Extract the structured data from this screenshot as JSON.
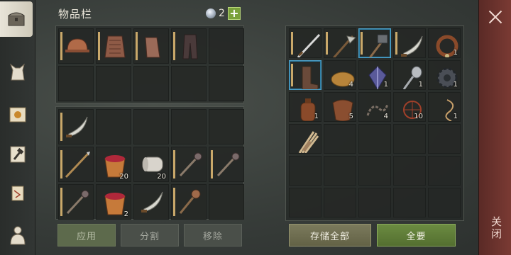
{
  "header": {
    "title": "物品栏",
    "gem_count": "2",
    "plus": "+"
  },
  "equip_slots": [
    {
      "icon": "helmet-icon",
      "count": "",
      "bar": true
    },
    {
      "icon": "chainmail-icon",
      "count": "",
      "bar": true
    },
    {
      "icon": "gloves-icon",
      "count": "",
      "bar": true
    },
    {
      "icon": "pants-icon",
      "count": "",
      "bar": true
    },
    {
      "icon": "",
      "count": "",
      "bar": false
    },
    {
      "icon": "",
      "count": "",
      "bar": false
    },
    {
      "icon": "",
      "count": "",
      "bar": false
    },
    {
      "icon": "",
      "count": "",
      "bar": false
    },
    {
      "icon": "",
      "count": "",
      "bar": false
    },
    {
      "icon": "",
      "count": "",
      "bar": false
    }
  ],
  "bag_slots": [
    {
      "icon": "scimitar-icon",
      "count": "",
      "bar": true
    },
    {
      "icon": "",
      "count": "",
      "bar": false
    },
    {
      "icon": "",
      "count": "",
      "bar": false
    },
    {
      "icon": "",
      "count": "",
      "bar": false
    },
    {
      "icon": "",
      "count": "",
      "bar": false
    },
    {
      "icon": "spear-icon",
      "count": "",
      "bar": true
    },
    {
      "icon": "berry-bucket-icon",
      "count": "20",
      "bar": false
    },
    {
      "icon": "cloth-roll-icon",
      "count": "20",
      "bar": false
    },
    {
      "icon": "mace-icon",
      "count": "",
      "bar": true
    },
    {
      "icon": "mace-icon",
      "count": "",
      "bar": true
    },
    {
      "icon": "mace-icon",
      "count": "",
      "bar": true
    },
    {
      "icon": "berry-bucket-icon",
      "count": "2",
      "bar": false
    },
    {
      "icon": "scimitar-icon",
      "count": "",
      "bar": false
    },
    {
      "icon": "flail-icon",
      "count": "",
      "bar": true
    },
    {
      "icon": "",
      "count": "",
      "bar": false
    }
  ],
  "storage_slots": [
    {
      "icon": "sword-icon",
      "count": "",
      "bar": true
    },
    {
      "icon": "halberd-icon",
      "count": "",
      "bar": true
    },
    {
      "icon": "sledgehammer-icon",
      "count": "",
      "bar": true,
      "selected": true
    },
    {
      "icon": "scimitar-icon",
      "count": "",
      "bar": true
    },
    {
      "icon": "collar-icon",
      "count": "1",
      "bar": false
    },
    {
      "icon": "boots-icon",
      "count": "",
      "bar": true,
      "selected": true
    },
    {
      "icon": "bread-icon",
      "count": "4",
      "bar": false
    },
    {
      "icon": "crystal-icon",
      "count": "1",
      "bar": false
    },
    {
      "icon": "spoon-icon",
      "count": "1",
      "bar": false
    },
    {
      "icon": "gear-icon",
      "count": "1",
      "bar": false
    },
    {
      "icon": "flask-icon",
      "count": "1",
      "bar": false
    },
    {
      "icon": "leather-icon",
      "count": "5",
      "bar": false
    },
    {
      "icon": "chain-icon",
      "count": "4",
      "bar": false
    },
    {
      "icon": "net-icon",
      "count": "10",
      "bar": false
    },
    {
      "icon": "rope-icon",
      "count": "1",
      "bar": false
    },
    {
      "icon": "sticks-icon",
      "count": "",
      "bar": false
    },
    {
      "icon": "",
      "count": "",
      "bar": false
    },
    {
      "icon": "",
      "count": "",
      "bar": false
    },
    {
      "icon": "",
      "count": "",
      "bar": false
    },
    {
      "icon": "",
      "count": "",
      "bar": false
    },
    {
      "icon": "",
      "count": "",
      "bar": false
    },
    {
      "icon": "",
      "count": "",
      "bar": false
    },
    {
      "icon": "",
      "count": "",
      "bar": false
    },
    {
      "icon": "",
      "count": "",
      "bar": false
    },
    {
      "icon": "",
      "count": "",
      "bar": false
    },
    {
      "icon": "",
      "count": "",
      "bar": false
    },
    {
      "icon": "",
      "count": "",
      "bar": false
    },
    {
      "icon": "",
      "count": "",
      "bar": false
    },
    {
      "icon": "",
      "count": "",
      "bar": false
    },
    {
      "icon": "",
      "count": "",
      "bar": false
    }
  ],
  "buttons": {
    "apply": "应用",
    "split": "分割",
    "remove": "移除",
    "store_all": "存储全部",
    "take_all": "全要"
  },
  "close_label": "关闭",
  "colors": {
    "accent_green": "#7aa13b",
    "close_bar": "#7a3a33",
    "selected_border": "#4da0c8"
  }
}
